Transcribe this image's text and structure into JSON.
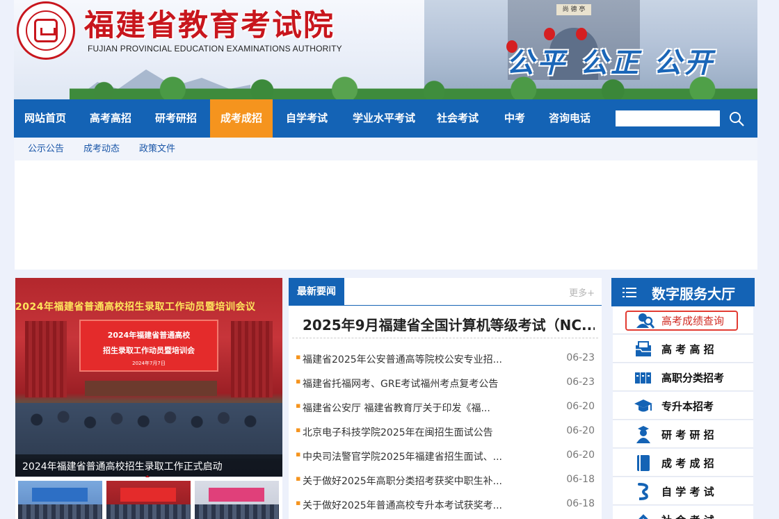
{
  "header": {
    "title": "福建省教育考试院",
    "subtitle": "FUJIAN PROVINCIAL EDUCATION EXAMINATIONS AUTHORITY",
    "slogan": "公平 公正 公开",
    "gate_plaque": "尚 德 亭"
  },
  "nav": {
    "items": [
      "网站首页",
      "高考高招",
      "研考研招",
      "成考成招",
      "自学考试",
      "学业水平考试",
      "社会考试",
      "中考",
      "咨询电话"
    ],
    "active_index": 3,
    "search_placeholder": ""
  },
  "subnav": {
    "items": [
      "公示公告",
      "成考动态",
      "政策文件"
    ]
  },
  "carousel": {
    "banner_text": "2024年福建省普通高校招生录取工作动员暨培训会议",
    "screen_line1": "2024年福建省普通高校",
    "screen_line2": "招生录取工作动员暨培训会",
    "screen_line3": "2024年7月7日",
    "caption": "2024年福建省普通高校招生录取工作正式启动"
  },
  "news": {
    "tab_label": "最新要闻",
    "more_label": "更多+",
    "headline": "2025年9月福建省全国计算机等级考试（NC...",
    "items": [
      {
        "title": "福建省2025年公安普通高等院校公安专业招...",
        "date": "06-23"
      },
      {
        "title": "福建省托福网考、GRE考试福州考点复考公告",
        "date": "06-23"
      },
      {
        "title": "福建省公安厅 福建省教育厅关于印发《福...",
        "date": "06-20"
      },
      {
        "title": "北京电子科技学院2025年在闽招生面试公告",
        "date": "06-20"
      },
      {
        "title": "中央司法警官学院2025年福建省招生面试、...",
        "date": "06-20"
      },
      {
        "title": "关于做好2025年高职分类招考获奖中职生补...",
        "date": "06-18"
      },
      {
        "title": "关于做好2025年普通高校专升本考试获奖考...",
        "date": "06-18"
      }
    ]
  },
  "service": {
    "title": "数字服务大厅",
    "items": [
      {
        "label": "高考成绩查询",
        "icon": "search-person-icon"
      },
      {
        "label": "高 考 高 招",
        "icon": "folder-icon"
      },
      {
        "label": "高职分类招考",
        "icon": "books-icon"
      },
      {
        "label": "专升本招考",
        "icon": "graduation-cap-icon"
      },
      {
        "label": "研 考 研 招",
        "icon": "graduate-icon"
      },
      {
        "label": "成 考 成 招",
        "icon": "book-icon"
      },
      {
        "label": "自 学 考 试",
        "icon": "self-study-icon"
      },
      {
        "label": "社 会 考 试",
        "icon": "society-icon"
      }
    ]
  },
  "colors": {
    "primary": "#1463b5",
    "accent_orange": "#f5941e",
    "brand_red": "#c8161d",
    "highlight_red": "#e23b32"
  }
}
